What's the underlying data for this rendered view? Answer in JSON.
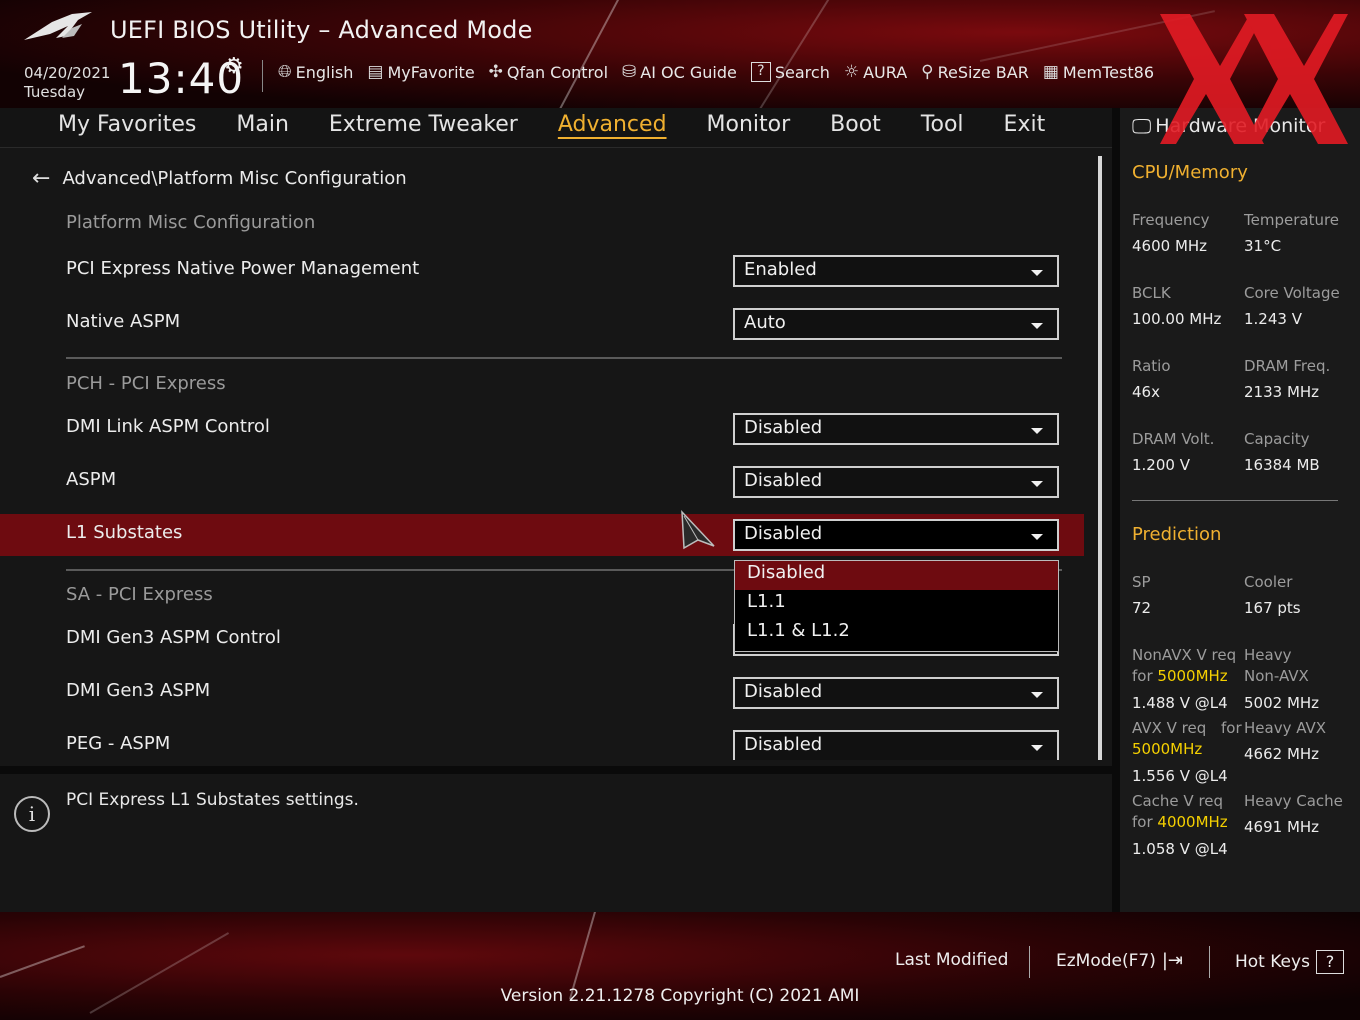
{
  "header": {
    "title": "UEFI BIOS Utility – Advanced Mode",
    "date": "04/20/2021",
    "day": "Tuesday",
    "time": "13:40",
    "toolbar": [
      {
        "icon": "globe-icon",
        "label": "English"
      },
      {
        "icon": "favorite-list-icon",
        "label": "MyFavorite"
      },
      {
        "icon": "fan-icon",
        "label": "Qfan Control"
      },
      {
        "icon": "ai-chip-icon",
        "label": "AI OC Guide"
      },
      {
        "icon": "help-box-icon",
        "label": "Search"
      },
      {
        "icon": "aura-light-icon",
        "label": "AURA"
      },
      {
        "icon": "resize-bar-icon",
        "label": "ReSize BAR"
      },
      {
        "icon": "memory-icon",
        "label": "MemTest86"
      }
    ]
  },
  "menu": {
    "items": [
      "My Favorites",
      "Main",
      "Extreme Tweaker",
      "Advanced",
      "Monitor",
      "Boot",
      "Tool",
      "Exit"
    ],
    "active": "Advanced"
  },
  "breadcrumb": "Advanced\\Platform Misc Configuration",
  "sections": {
    "platform": "Platform Misc Configuration",
    "pch": "PCH - PCI Express",
    "sa": "SA - PCI Express"
  },
  "settings": [
    {
      "label": "PCI Express Native Power Management",
      "value": "Enabled"
    },
    {
      "label": "Native ASPM",
      "value": "Auto"
    },
    {
      "label": "DMI Link ASPM Control",
      "value": "Disabled"
    },
    {
      "label": "ASPM",
      "value": "Disabled"
    },
    {
      "label": "L1 Substates",
      "value": "Disabled"
    },
    {
      "label": "DMI Gen3 ASPM Control",
      "value": ""
    },
    {
      "label": "DMI Gen3 ASPM",
      "value": "Disabled"
    },
    {
      "label": "PEG - ASPM",
      "value": "Disabled"
    }
  ],
  "popup": {
    "options": [
      "Disabled",
      "L1.1",
      "L1.1 & L1.2"
    ],
    "selected": "Disabled"
  },
  "help": {
    "text": "PCI Express L1 Substates settings."
  },
  "hw_monitor": {
    "title": "Hardware Monitor",
    "cpu_memory": {
      "title": "CPU/Memory",
      "frequency_label": "Frequency",
      "frequency": "4600 MHz",
      "temperature_label": "Temperature",
      "temperature": "31°C",
      "bclk_label": "BCLK",
      "bclk": "100.00 MHz",
      "core_voltage_label": "Core Voltage",
      "core_voltage": "1.243 V",
      "ratio_label": "Ratio",
      "ratio": "46x",
      "dram_freq_label": "DRAM Freq.",
      "dram_freq": "2133 MHz",
      "dram_volt_label": "DRAM Volt.",
      "dram_volt": "1.200 V",
      "capacity_label": "Capacity",
      "capacity": "16384 MB"
    },
    "prediction": {
      "title": "Prediction",
      "sp_label": "SP",
      "sp": "72",
      "cooler_label": "Cooler",
      "cooler": "167 pts",
      "nonavx_label1": "NonAVX V req",
      "nonavx_label2": "for",
      "nonavx_freq": "5000MHz",
      "nonavx_val": "1.488 V @L4",
      "heavy_nonavx_label1": "Heavy",
      "heavy_nonavx_label2": "Non-AVX",
      "heavy_nonavx": "5002 MHz",
      "avx_label1": "AVX V req",
      "avx_label2": "for",
      "avx_freq": "5000MHz",
      "avx_val": "1.556 V @L4",
      "heavy_avx_label": "Heavy AVX",
      "heavy_avx": "4662 MHz",
      "cache_label1": "Cache V req",
      "cache_label2": "for",
      "cache_freq": "4000MHz",
      "cache_val": "1.058 V @L4",
      "heavy_cache_label": "Heavy Cache",
      "heavy_cache": "4691 MHz"
    }
  },
  "footer": {
    "last_modified": "Last Modified",
    "ezmode": "EzMode(F7)",
    "hot_keys": "Hot Keys",
    "hot_keys_box": "?",
    "version": "Version 2.21.1278 Copyright (C) 2021 AMI"
  },
  "colors": {
    "accent": "#f0b030",
    "highlight_row": "#6e0b10",
    "value_highlight": "#f5d000"
  }
}
